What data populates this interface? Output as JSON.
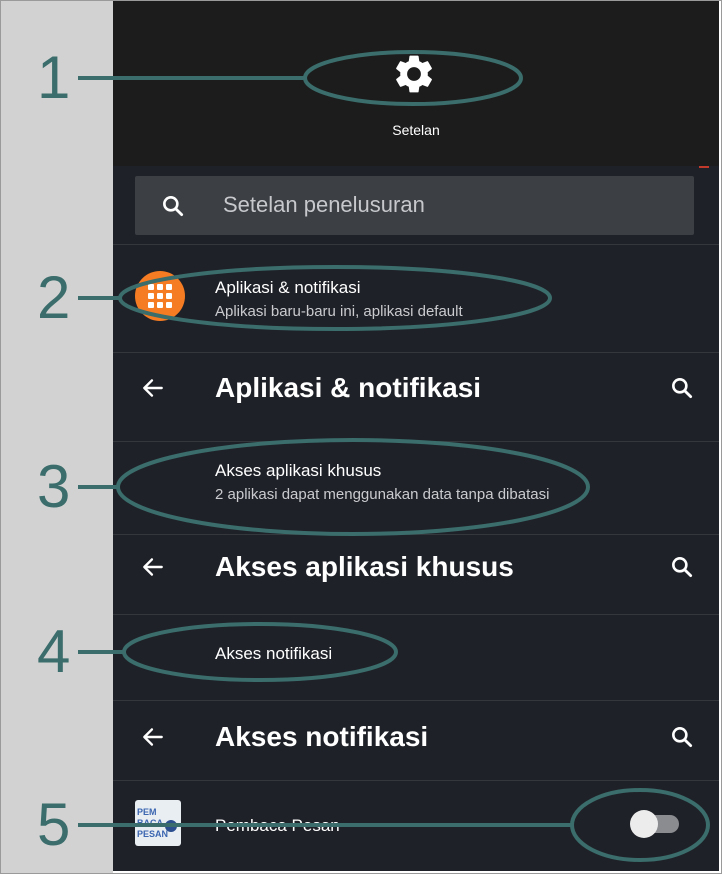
{
  "header": {
    "title": "Setelan",
    "icon": "gear-icon"
  },
  "search": {
    "placeholder": "Setelan penelusuran",
    "icon": "search-icon"
  },
  "apps_row": {
    "title": "Aplikasi & notifikasi",
    "subtitle": "Aplikasi baru-baru ini, aplikasi default",
    "icon": "apps-grid-icon",
    "icon_color": "#f57c22"
  },
  "apps_bar": {
    "title": "Aplikasi & notifikasi"
  },
  "special_access_row": {
    "title": "Akses aplikasi khusus",
    "subtitle": "2 aplikasi dapat menggunakan data tanpa dibatasi"
  },
  "special_access_bar": {
    "title": "Akses aplikasi khusus"
  },
  "notif_access_row": {
    "title": "Akses notifikasi"
  },
  "notif_access_bar": {
    "title": "Akses notifikasi"
  },
  "app_item": {
    "name": "Pembaca Pesan",
    "logo_lines": [
      "PEM",
      "BACA",
      "PESAN"
    ],
    "toggle_on": false
  },
  "callouts": [
    "1",
    "2",
    "3",
    "4",
    "5"
  ],
  "colors": {
    "background": "#1f2128",
    "header": "#1c1c1c",
    "annotation": "#3a6d6b",
    "accent": "#f57c22"
  }
}
